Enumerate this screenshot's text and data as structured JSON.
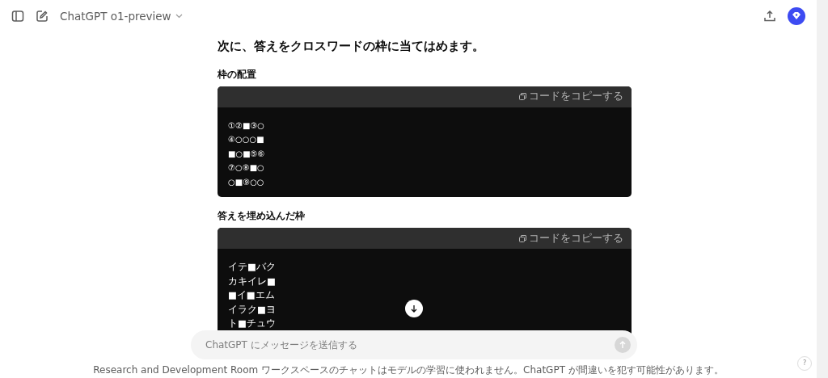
{
  "header": {
    "model": "ChatGPT o1-preview"
  },
  "heading": "次に、答えをクロスワードの枠に当てはめます。",
  "sections": [
    {
      "title": "枠の配置",
      "copy_label": "コードをコピーする",
      "lines": [
        "①②■③○",
        "④○○○■",
        "■○■⑤⑥",
        "⑦○⑧■○",
        "○■⑨○○"
      ],
      "kind": "small"
    },
    {
      "title": "答えを埋め込んだ枠",
      "copy_label": "コードをコピーする",
      "lines": [
        "イテ■バク",
        "カキイレ■",
        "■イ■エム",
        "イラク■ヨ",
        "ト■チュウ"
      ],
      "kind": "normal"
    }
  ],
  "composer": {
    "placeholder": "ChatGPT にメッセージを送信する"
  },
  "footer": "Research and Development Room ワークスペースのチャットはモデルの学習に使われません。ChatGPT が間違いを犯す可能性があります。",
  "help": "?"
}
